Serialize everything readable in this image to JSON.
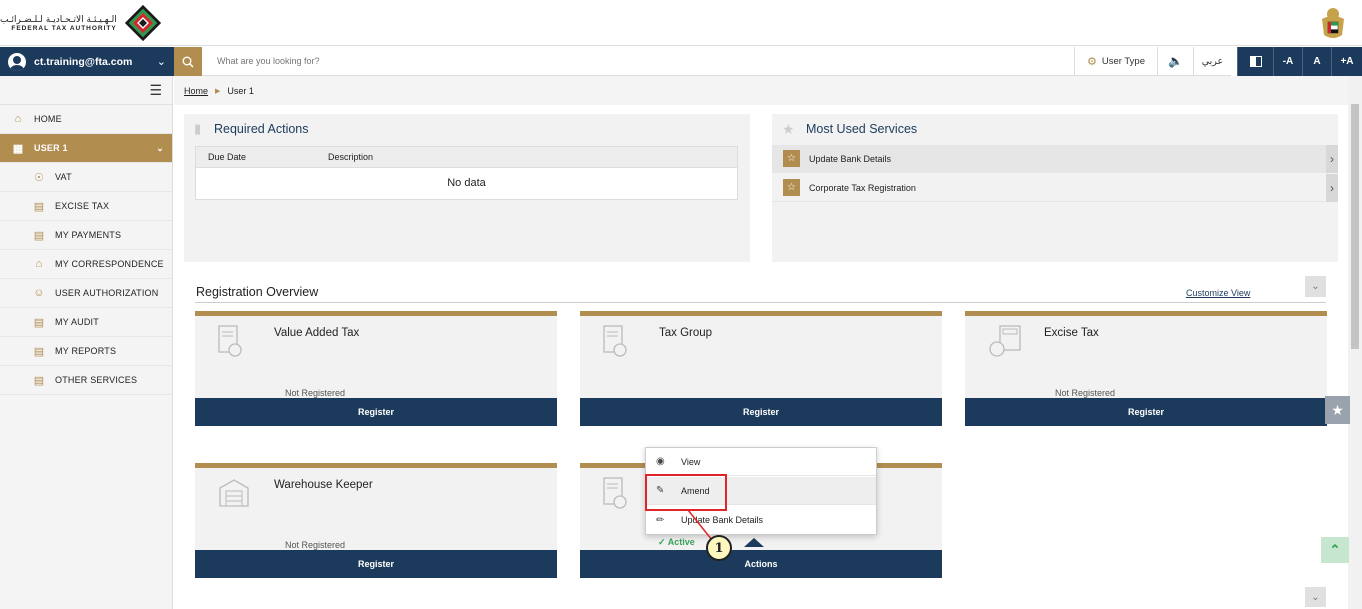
{
  "header": {
    "logo_ar": "الـهـيـئـة الاتـحـاديـة لـلـضـرائـب",
    "logo_en": "FEDERAL TAX AUTHORITY",
    "logo_icon": "fta-logo",
    "emblem_icon": "uae-emblem"
  },
  "topbar": {
    "user_email": "ct.training@fta.com",
    "search_placeholder": "What are you looking for?",
    "user_type_label": "User Type",
    "arabic_label": "عربي",
    "font_minus": "-A",
    "font_normal": "A",
    "font_plus": "+A"
  },
  "sidebar": {
    "items": [
      {
        "label": "HOME",
        "icon": "home-icon"
      },
      {
        "label": "USER 1",
        "icon": "grid-icon",
        "active": true
      },
      {
        "label": "VAT",
        "icon": "vat-icon"
      },
      {
        "label": "EXCISE TAX",
        "icon": "excise-icon"
      },
      {
        "label": "MY PAYMENTS",
        "icon": "payments-icon"
      },
      {
        "label": "MY CORRESPONDENCE",
        "icon": "building-icon"
      },
      {
        "label": "USER AUTHORIZATION",
        "icon": "user-auth-icon"
      },
      {
        "label": "MY AUDIT",
        "icon": "audit-icon"
      },
      {
        "label": "MY REPORTS",
        "icon": "reports-icon"
      },
      {
        "label": "OTHER SERVICES",
        "icon": "services-icon"
      }
    ]
  },
  "breadcrumb": {
    "home": "Home",
    "current": "User 1"
  },
  "required_actions": {
    "title": "Required Actions",
    "col_due": "Due Date",
    "col_desc": "Description",
    "empty": "No data"
  },
  "most_used": {
    "title": "Most Used Services",
    "items": [
      "Update Bank Details",
      "Corporate Tax Registration"
    ]
  },
  "registration": {
    "title": "Registration Overview",
    "customize": "Customize View",
    "cards": [
      {
        "title": "Value Added Tax",
        "status": "Not Registered",
        "button": "Register"
      },
      {
        "title": "Tax Group",
        "status": "",
        "button": "Register"
      },
      {
        "title": "Excise Tax",
        "status": "Not Registered",
        "button": "Register"
      },
      {
        "title": "Warehouse Keeper",
        "status": "Not Registered",
        "button": "Register"
      },
      {
        "title": "",
        "status": "Active",
        "button": "Actions"
      }
    ]
  },
  "actions_menu": {
    "items": [
      "View",
      "Amend",
      "Update Bank Details"
    ]
  },
  "annotation": {
    "step": "1"
  },
  "colors": {
    "navy": "#1c3a5c",
    "gold": "#b28d50",
    "highlight": "#e0242a"
  }
}
